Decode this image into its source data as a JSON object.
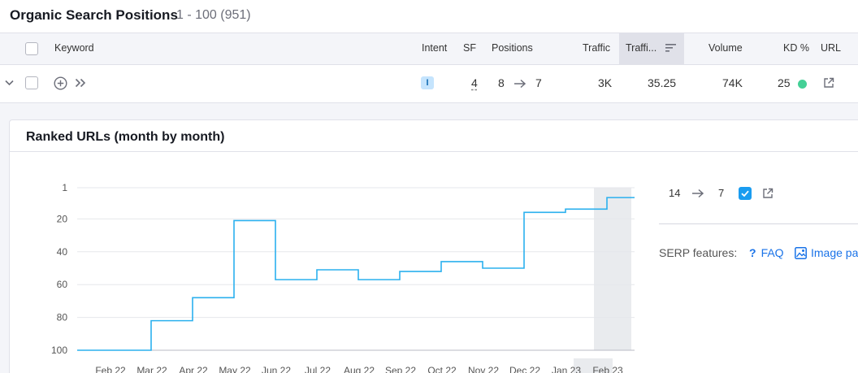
{
  "header": {
    "title": "Organic Search Positions",
    "count": "1 - 100 (951)"
  },
  "table": {
    "columns": {
      "keyword": "Keyword",
      "intent": "Intent",
      "sf": "SF",
      "positions": "Positions",
      "traffic": "Traffic",
      "traffic_pct": "Traffi...",
      "volume": "Volume",
      "kd": "KD %",
      "url": "URL"
    },
    "row": {
      "intent": "I",
      "sf": "4",
      "pos_from": "8",
      "pos_to": "7",
      "traffic": "3K",
      "traffic_pct": "35.25",
      "volume": "74K",
      "kd": "25",
      "kd_color": "#44d096"
    }
  },
  "ranked_card": {
    "title": "Ranked URLs (month by month)"
  },
  "chart_data": {
    "type": "line",
    "step": true,
    "y_reversed": true,
    "y_ticks": [
      "1",
      "20",
      "40",
      "60",
      "80",
      "100"
    ],
    "y_tick_values": [
      1,
      20,
      40,
      60,
      80,
      100
    ],
    "ylim": [
      1,
      100
    ],
    "x_categories": [
      "Feb 22",
      "Mar 22",
      "Apr 22",
      "May 22",
      "Jun 22",
      "Jul 22",
      "Aug 22",
      "Sep 22",
      "Oct 22",
      "Nov 22",
      "Dec 22",
      "Jan 23",
      "Feb 23"
    ],
    "series": [
      {
        "color": "#2bb0ee",
        "values": [
          100,
          82,
          68,
          21,
          57,
          51,
          57,
          52,
          46,
          50,
          16,
          14,
          7
        ]
      }
    ],
    "highlight_category": "Feb 23",
    "grid": true
  },
  "side": {
    "pos_from": "14",
    "pos_to": "7",
    "serp_label": "SERP features:",
    "features": [
      "FAQ",
      "Image pa"
    ]
  },
  "colors": {
    "line": "#2bb0ee",
    "link": "#1a73e8",
    "highlight": "#e9ebee"
  }
}
